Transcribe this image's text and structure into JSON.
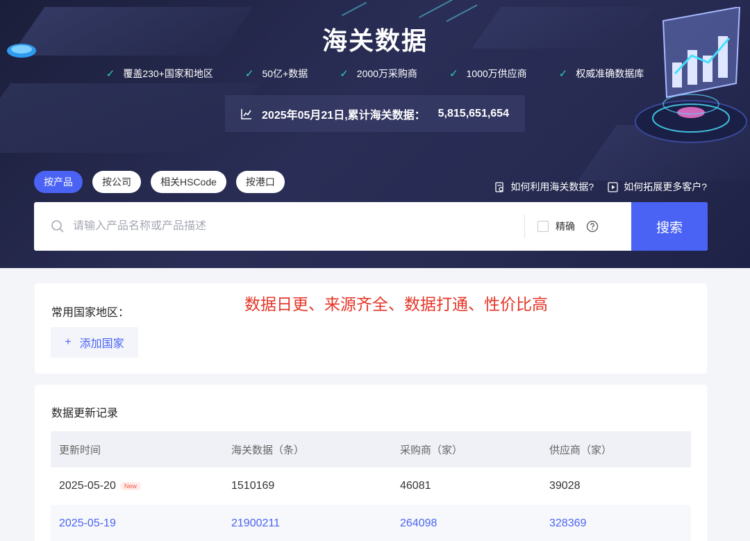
{
  "hero": {
    "title": "海关数据",
    "features": [
      "覆盖230+国家和地区",
      "50亿+数据",
      "2000万采购商",
      "1000万供应商",
      "权威准确数据库"
    ],
    "stat_label": "2025年05月21日,累计海关数据：",
    "stat_value": "5,815,651,654"
  },
  "search": {
    "tabs": [
      "按产品",
      "按公司",
      "相关HSCode",
      "按港口"
    ],
    "active_tab": 0,
    "help_links": [
      "如何利用海关数据?",
      "如何拓展更多客户?"
    ],
    "placeholder": "请输入产品名称或产品描述",
    "value": "",
    "exact_label": "精确",
    "button_label": "搜索"
  },
  "countries": {
    "title": "常用国家地区：",
    "promo_text": "数据日更、来源齐全、数据打通、性价比高",
    "add_label": "添加国家",
    "add_symbol": "+"
  },
  "records": {
    "title": "数据更新记录",
    "columns": [
      "更新时间",
      "海关数据（条）",
      "采购商（家）",
      "供应商（家）"
    ],
    "rows": [
      {
        "date": "2025-05-20",
        "badge": "New",
        "customs": "1510169",
        "buyers": "46081",
        "suppliers": "39028"
      },
      {
        "date": "2025-05-19",
        "badge": "",
        "customs": "21900211",
        "buyers": "264098",
        "suppliers": "328369"
      }
    ]
  },
  "colors": {
    "accent": "#4a63f4",
    "check": "#2ed4b1",
    "promo": "#e53527",
    "hero_bg": "#252a4f"
  }
}
